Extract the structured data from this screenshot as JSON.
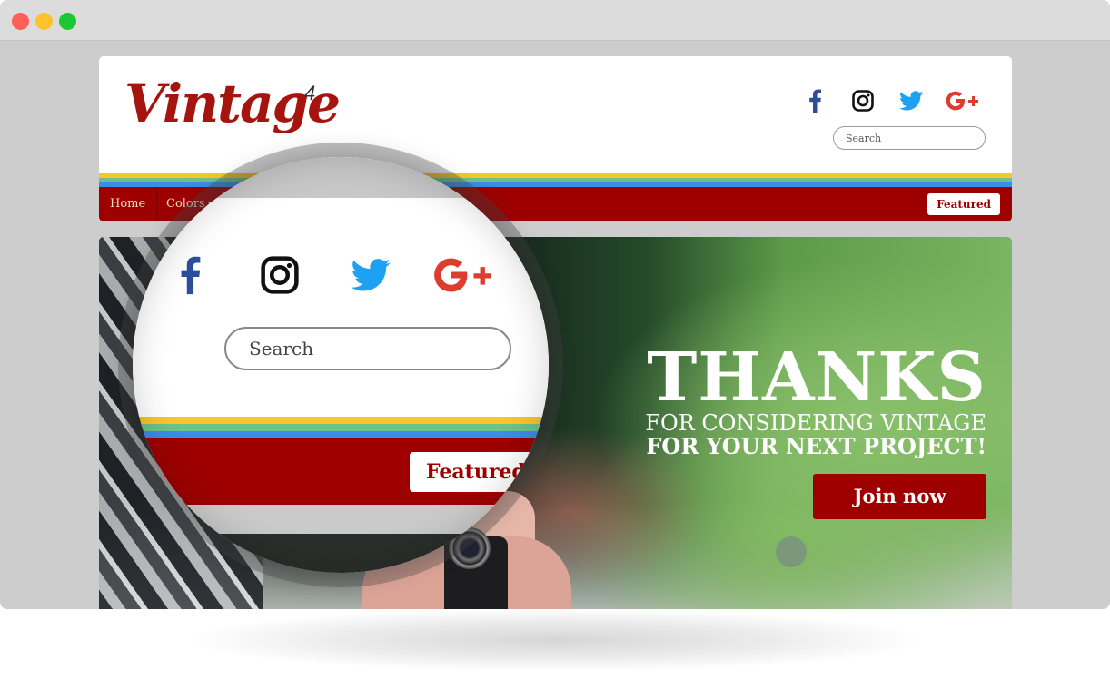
{
  "window": {
    "controls": [
      "close",
      "minimize",
      "maximize"
    ]
  },
  "header": {
    "logo_text": "Vintage",
    "logo_superscript": "4",
    "social": [
      {
        "name": "facebook",
        "icon": "facebook-icon",
        "color": "#2d4f9a"
      },
      {
        "name": "instagram",
        "icon": "instagram-icon",
        "color": "#111111"
      },
      {
        "name": "twitter",
        "icon": "twitter-icon",
        "color": "#1da1f2"
      },
      {
        "name": "google-plus",
        "icon": "google-plus-icon",
        "color": "#dc3d2f"
      }
    ],
    "search_placeholder": "Search",
    "stripe_colors": [
      "#f8c52b",
      "#6cc28d",
      "#3b8de8"
    ]
  },
  "nav": {
    "items": [
      {
        "label": "Home"
      },
      {
        "label": "Colors",
        "has_dropdown": true
      }
    ],
    "featured_label": "Featured",
    "bar_color": "#9e0000"
  },
  "hero": {
    "headline": "THANKS",
    "subline_1": "FOR CONSIDERING VINTAGE",
    "subline_2": "FOR YOUR NEXT PROJECT!",
    "cta_label": "Join now"
  },
  "magnifier": {
    "search_placeholder": "Search",
    "featured_label": "Featured"
  }
}
